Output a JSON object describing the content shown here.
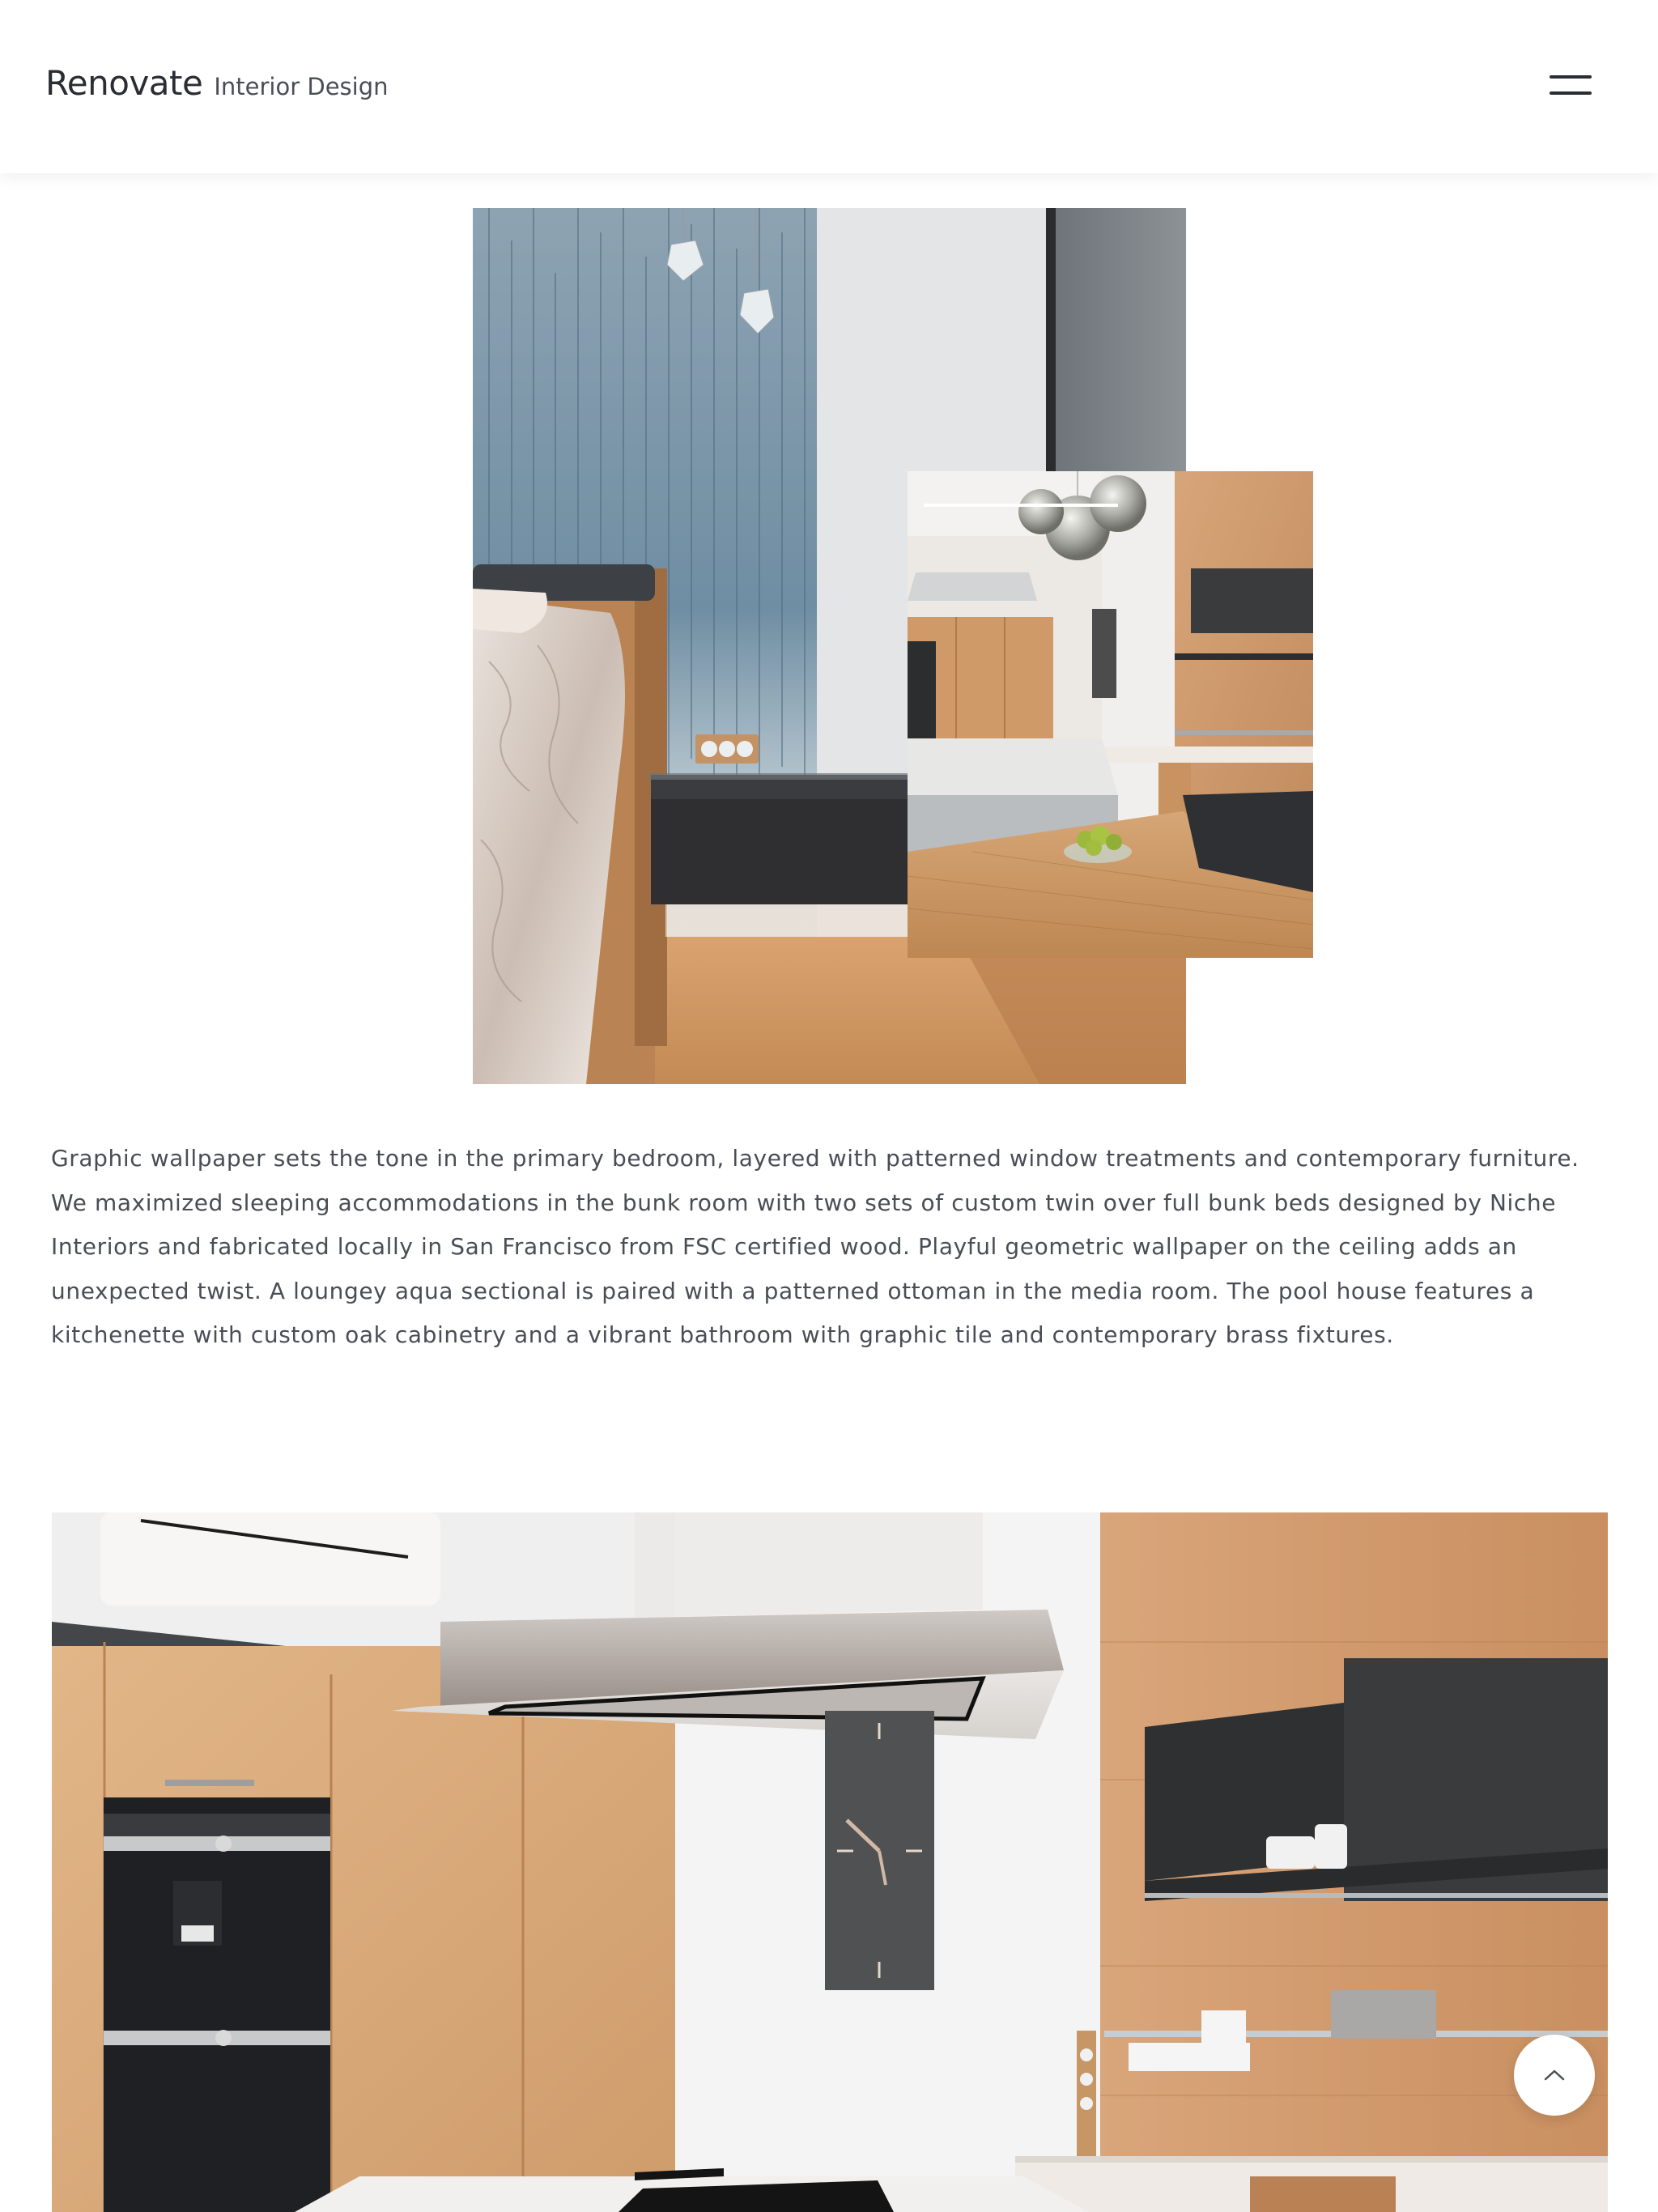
{
  "header": {
    "brand_name": "Renovate",
    "brand_tagline": "Interior Design",
    "menu_icon": "hamburger-menu-icon"
  },
  "gallery": {
    "images": [
      {
        "alt": "Bedroom with blue graphic wallpaper, wooden bed and dark nightstand"
      },
      {
        "alt": "Kitchen with oak cabinetry, wall clock, pendant lights and dining table"
      }
    ]
  },
  "description": "Graphic wallpaper sets the tone in the primary bedroom, layered with patterned window treatments and contemporary furniture. We maximized sleeping accommodations in the bunk room with two sets of custom twin over full bunk beds designed by Niche Interiors and fabricated locally in San Francisco from FSC certified wood. Playful geometric wallpaper on the ceiling adds an unexpected twist. A loungey aqua sectional is paired with a patterned ottoman in the media room. The pool house features a kitchenette with custom oak cabinetry and a vibrant bathroom with graphic tile and contemporary brass fixtures.",
  "feature_image": {
    "alt": "Modern kitchen with stainless range hood, oak cabinets, built-in ovens and wall clock"
  },
  "back_to_top": {
    "icon": "chevron-up-icon"
  },
  "colors": {
    "text": "#2b2d33",
    "body_text": "#4a4d55",
    "background": "#ffffff",
    "oak": "#c9966a",
    "charcoal": "#3a3b3d"
  }
}
